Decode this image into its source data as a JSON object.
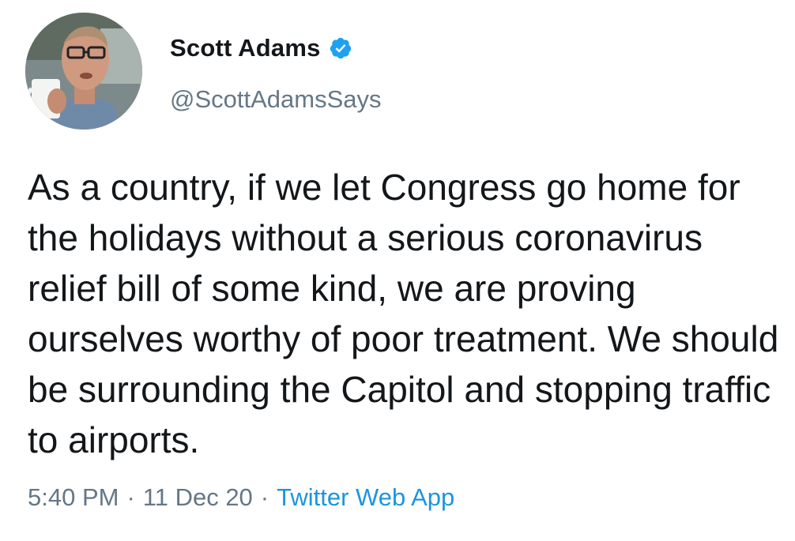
{
  "user": {
    "display_name": "Scott Adams",
    "handle": "@ScottAdamsSays",
    "verified": true
  },
  "tweet": {
    "text": "As a country, if we let Congress go home for the holidays without a serious coronavirus relief bill of some kind, we are proving ourselves worthy of poor treatment. We should be surrounding the Capitol and stopping traffic to airports."
  },
  "meta": {
    "time": "5:40 PM",
    "separator": "·",
    "date": "11 Dec 20",
    "source": "Twitter Web App"
  },
  "colors": {
    "text": "#14171a",
    "secondary": "#657786",
    "link": "#1b95e0",
    "verified_badge": "#1da1f2"
  },
  "icons": {
    "verified": "verified-badge-icon",
    "avatar": "profile-avatar"
  }
}
